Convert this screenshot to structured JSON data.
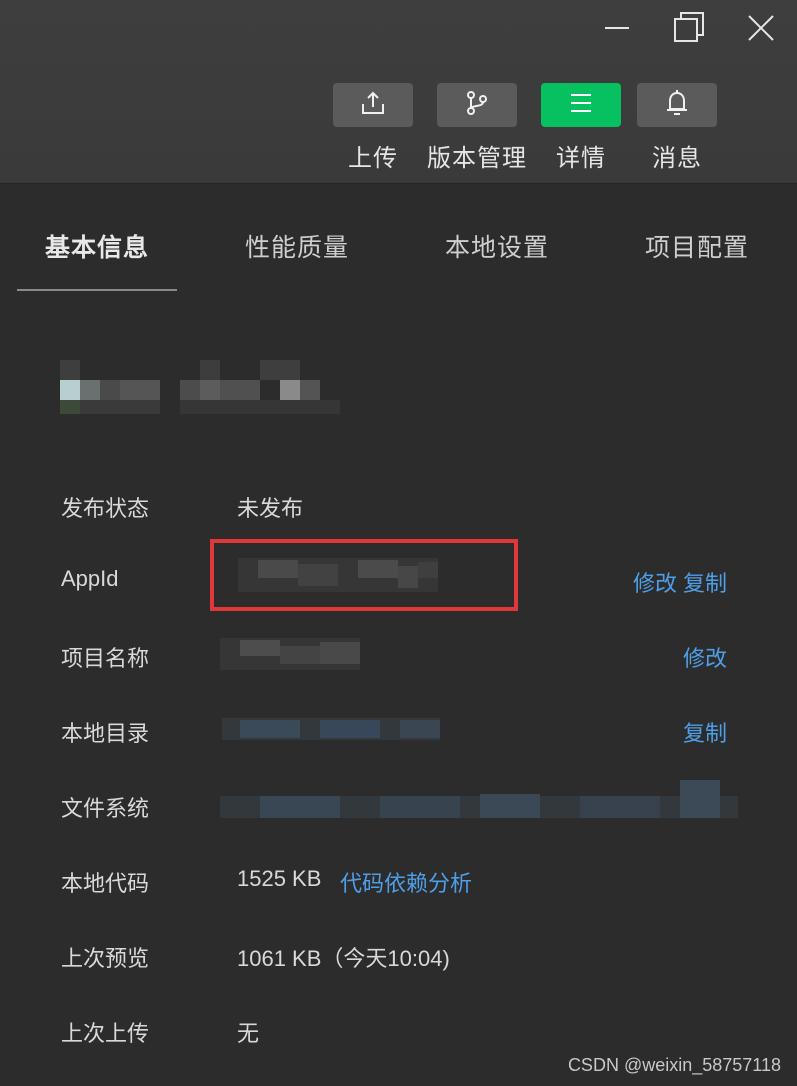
{
  "window_controls": {
    "minimize_icon": "minimize-icon",
    "restore_icon": "restore-icon",
    "close_icon": "close-icon"
  },
  "toolbar": {
    "buttons": [
      {
        "label": "上传",
        "icon": "upload-icon"
      },
      {
        "label": "版本管理",
        "icon": "branch-icon"
      },
      {
        "label": "详情",
        "icon": "menu-lines-icon",
        "active": true
      },
      {
        "label": "消息",
        "icon": "bell-icon"
      }
    ],
    "active_color": "#07c160"
  },
  "tabs": [
    {
      "label": "基本信息",
      "active": true
    },
    {
      "label": "性能质量"
    },
    {
      "label": "本地设置"
    },
    {
      "label": "项目配置"
    }
  ],
  "info": {
    "rows": [
      {
        "label": "发布状态",
        "value": "未发布"
      },
      {
        "label": "AppId",
        "links": [
          "修改",
          "复制"
        ]
      },
      {
        "label": "项目名称",
        "links": [
          "修改"
        ]
      },
      {
        "label": "本地目录",
        "links": [
          "复制"
        ]
      },
      {
        "label": "文件系统"
      },
      {
        "label": "本地代码",
        "value": "1525 KB",
        "links": [
          "代码依赖分析"
        ]
      },
      {
        "label": "上次预览",
        "value": "1061 KB（今天10:04)"
      },
      {
        "label": "上次上传",
        "value": "无"
      }
    ]
  },
  "colors": {
    "link": "#4e9ee8",
    "highlight_border": "#e03838",
    "background": "#2c2c2c"
  },
  "watermark": "CSDN @weixin_58757118"
}
